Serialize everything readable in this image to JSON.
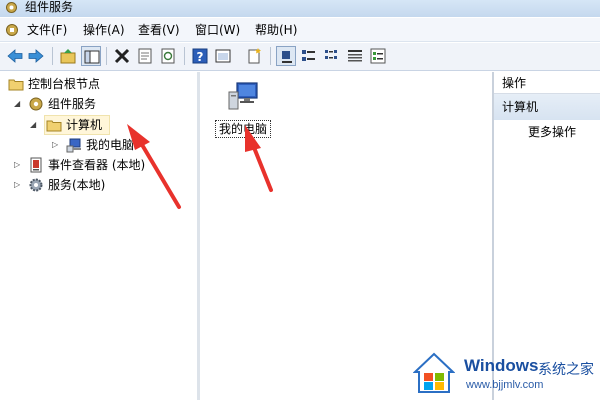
{
  "window": {
    "title": "组件服务"
  },
  "menu": {
    "items": [
      {
        "label": "文件(F)"
      },
      {
        "label": "操作(A)"
      },
      {
        "label": "查看(V)"
      },
      {
        "label": "窗口(W)"
      },
      {
        "label": "帮助(H)"
      }
    ]
  },
  "toolbar": {
    "icons": [
      "back-icon",
      "forward-icon",
      "up-folder-icon",
      "show-tree-icon",
      "delete-icon",
      "properties-icon",
      "refresh-icon",
      "help-icon",
      "view-icon",
      "new-icon",
      "large-icons-icon",
      "small-icons-icon",
      "list-icon",
      "details-icon",
      "status-icon"
    ]
  },
  "tree": {
    "root": "控制台根节点",
    "items": [
      {
        "label": "组件服务",
        "expanded": true
      },
      {
        "label": "计算机",
        "expanded": true,
        "selected": true
      },
      {
        "label": "我的电脑",
        "expanded": false
      },
      {
        "label": "事件查看器 (本地)",
        "expanded": false
      },
      {
        "label": "服务(本地)",
        "expanded": false
      }
    ]
  },
  "content": {
    "items": [
      {
        "label": "我的电脑",
        "icon": "computer-icon"
      }
    ]
  },
  "actions": {
    "header": "操作",
    "group": "计算机",
    "more": "更多操作"
  },
  "watermark": {
    "brand": "Windows",
    "sub": "系统之家",
    "url": "www.bjjmlv.com"
  },
  "colors": {
    "arrow": "#e8322c",
    "selection": "#fff6d9",
    "actions_group": "#dce6f2",
    "watermark_text": "#1a4fa0"
  }
}
